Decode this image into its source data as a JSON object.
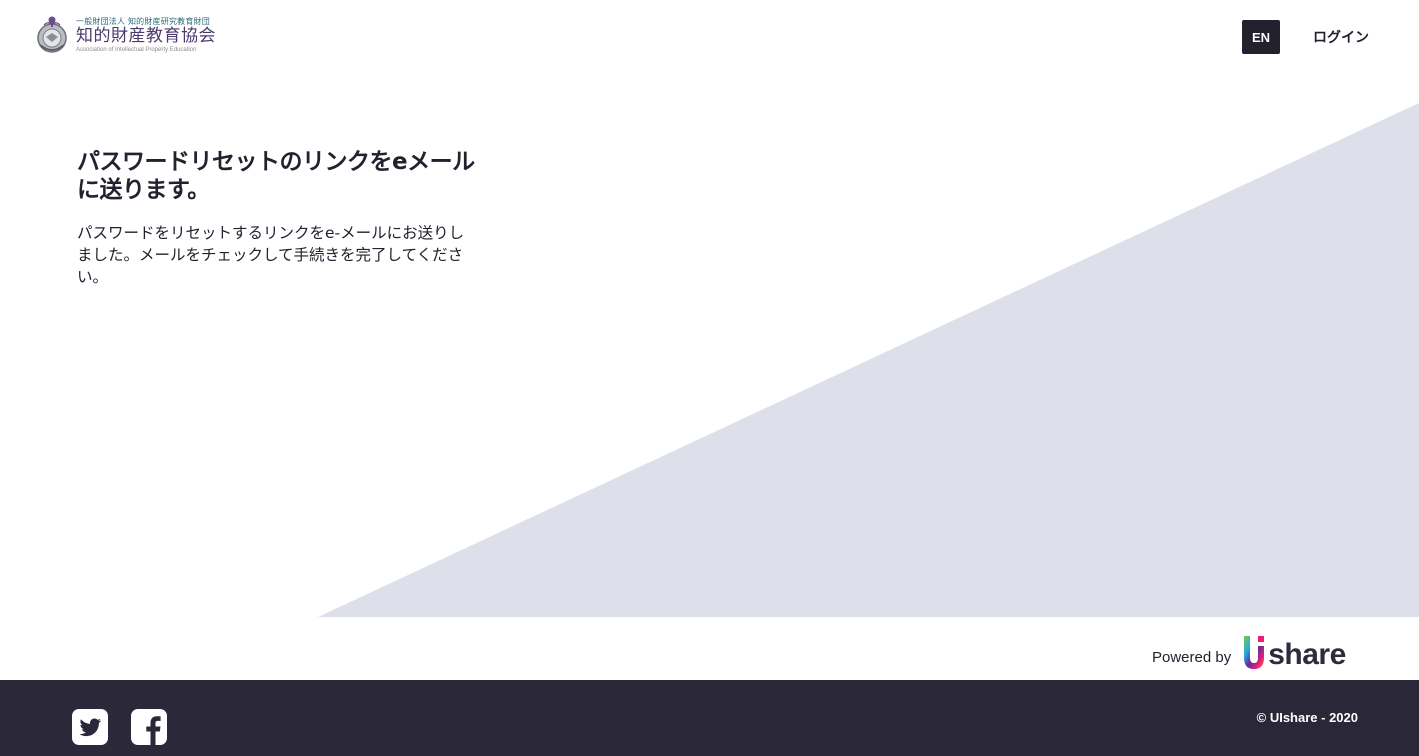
{
  "header": {
    "logo": {
      "org_line": "一般財団法人 知的財産研究教育財団",
      "name": "知的財産教育協会",
      "name_en": "Association of Intellectual Property Education"
    },
    "language_button": "EN",
    "login_link": "ログイン"
  },
  "main": {
    "title": "パスワードリセットのリンクをeメールに送ります。",
    "message": "パスワードをリセットするリンクをe-メールにお送りしました。メールをチェックして手続きを完了してください。"
  },
  "powered_by": {
    "label": "Powered by",
    "brand_text": "share"
  },
  "footer": {
    "social": [
      "twitter-icon",
      "facebook-icon"
    ],
    "copyright": "© UIshare - 2020"
  },
  "colors": {
    "dark": "#23212e",
    "footer_bg": "#2b2939",
    "triangle": "#dde0ea",
    "accent_teal": "#2d6a7a"
  }
}
